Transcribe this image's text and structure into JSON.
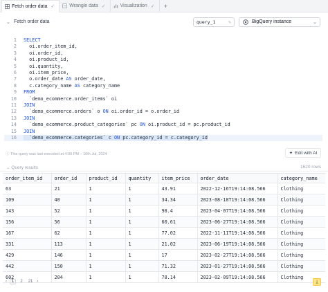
{
  "tabs": [
    {
      "label": "Fetch order data",
      "icon": "grid-icon",
      "active": true
    },
    {
      "label": "Wrangle data",
      "icon": "wrangle-icon",
      "active": false
    },
    {
      "label": "Visualization",
      "icon": "chart-icon",
      "active": false
    }
  ],
  "tab_add": "+",
  "cell": {
    "name": "Fetch order data",
    "variable": "query_1",
    "source": "BigQuery instance"
  },
  "editor": {
    "lines": [
      {
        "n": "1",
        "tokens": [
          {
            "k": "kw",
            "t": "SELECT"
          }
        ]
      },
      {
        "n": "2",
        "tokens": [
          {
            "k": "",
            "t": "  oi.order_item_id,"
          }
        ]
      },
      {
        "n": "3",
        "tokens": [
          {
            "k": "",
            "t": "  oi.order_id,"
          }
        ]
      },
      {
        "n": "4",
        "tokens": [
          {
            "k": "",
            "t": "  oi.product_id,"
          }
        ]
      },
      {
        "n": "5",
        "tokens": [
          {
            "k": "",
            "t": "  oi.quantity,"
          }
        ]
      },
      {
        "n": "6",
        "tokens": [
          {
            "k": "",
            "t": "  oi.item_price,"
          }
        ]
      },
      {
        "n": "7",
        "tokens": [
          {
            "k": "",
            "t": "  o.order_date "
          },
          {
            "k": "kw",
            "t": "AS"
          },
          {
            "k": "",
            "t": " order_date,"
          }
        ]
      },
      {
        "n": "8",
        "tokens": [
          {
            "k": "",
            "t": "  c.category_name "
          },
          {
            "k": "kw",
            "t": "AS"
          },
          {
            "k": "",
            "t": " category_name"
          }
        ]
      },
      {
        "n": "9",
        "tokens": [
          {
            "k": "kw",
            "t": "FROM"
          }
        ]
      },
      {
        "n": "10",
        "tokens": [
          {
            "k": "",
            "t": "  `demo_ecommerce.order_items` oi"
          }
        ]
      },
      {
        "n": "11",
        "tokens": [
          {
            "k": "kw",
            "t": "JOIN"
          }
        ]
      },
      {
        "n": "12",
        "tokens": [
          {
            "k": "",
            "t": "  `demo_ecommerce.orders` o "
          },
          {
            "k": "kw",
            "t": "ON"
          },
          {
            "k": "",
            "t": " oi.order_id = o.order_id"
          }
        ]
      },
      {
        "n": "13",
        "tokens": [
          {
            "k": "kw",
            "t": "JOIN"
          }
        ]
      },
      {
        "n": "14",
        "tokens": [
          {
            "k": "",
            "t": "  `demo_ecommerce.product_categories` pc "
          },
          {
            "k": "kw",
            "t": "ON"
          },
          {
            "k": "",
            "t": " oi.product_id = pc.product_id"
          }
        ]
      },
      {
        "n": "15",
        "tokens": [
          {
            "k": "kw",
            "t": "JOIN"
          }
        ]
      },
      {
        "n": "16",
        "tokens": [
          {
            "k": "sel",
            "t": "  `demo_ecommerce.categories` c "
          },
          {
            "k": "kw sel",
            "t": "ON"
          },
          {
            "k": "sel",
            "t": " pc.category_id = c.category_id"
          }
        ]
      }
    ]
  },
  "exec_note": "This query was last executed at 4:00 PM – 10th Jul, 2024",
  "edit_ai_label": "Edit with AI",
  "results": {
    "label": "Query results",
    "row_count": "1620 rows",
    "columns": [
      "order_item_id",
      "order_id",
      "product_id",
      "quantity",
      "item_price",
      "order_date",
      "category_name"
    ],
    "rows": [
      [
        "63",
        "21",
        "1",
        "1",
        "43.91",
        "2022-12-16T19:14:08.566",
        "Clothing"
      ],
      [
        "109",
        "40",
        "1",
        "1",
        "34.34",
        "2023-08-18T19:14:08.566",
        "Clothing"
      ],
      [
        "143",
        "52",
        "1",
        "1",
        "98.4",
        "2023-04-07T19:14:08.566",
        "Clothing"
      ],
      [
        "156",
        "56",
        "1",
        "1",
        "60.61",
        "2023-06-27T19:14:08.566",
        "Clothing"
      ],
      [
        "167",
        "62",
        "1",
        "1",
        "77.02",
        "2022-11-11T19:14:08.566",
        "Clothing"
      ],
      [
        "331",
        "113",
        "1",
        "1",
        "21.02",
        "2023-06-19T19:14:08.566",
        "Clothing"
      ],
      [
        "429",
        "146",
        "1",
        "1",
        "17",
        "2023-02-27T19:14:08.566",
        "Clothing"
      ],
      [
        "442",
        "150",
        "1",
        "1",
        "71.32",
        "2023-01-27T19:14:08.566",
        "Clothing"
      ],
      [
        "602",
        "204",
        "1",
        "1",
        "78.14",
        "2023-02-09T19:14:08.566",
        "Clothing"
      ]
    ]
  },
  "pager": {
    "pages": [
      "1",
      "2",
      "21"
    ],
    "current": "1",
    "prev": "‹",
    "next": "›"
  },
  "download_icon": "download-icon",
  "colors": {
    "keyword": "#1d4ed8",
    "selection": "#dbe6f7",
    "download_bg": "#fde68a"
  }
}
